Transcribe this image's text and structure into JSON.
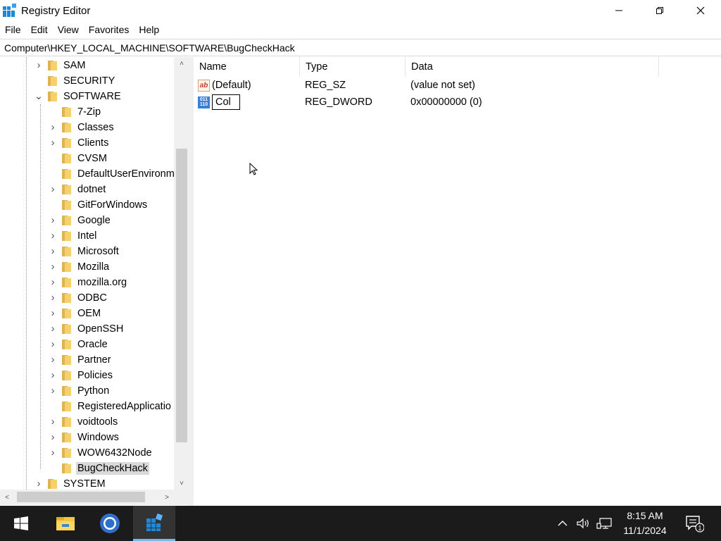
{
  "window": {
    "title": "Registry Editor",
    "controls": [
      "minimize",
      "restore",
      "close"
    ]
  },
  "menu": [
    "File",
    "Edit",
    "View",
    "Favorites",
    "Help"
  ],
  "address": "Computer\\HKEY_LOCAL_MACHINE\\SOFTWARE\\BugCheckHack",
  "tree": {
    "top_level": [
      {
        "label": "SAM",
        "expandable": true
      },
      {
        "label": "SECURITY",
        "expandable": false
      },
      {
        "label": "SOFTWARE",
        "expandable": true,
        "expanded": true
      }
    ],
    "software_children": [
      {
        "label": "7-Zip",
        "expandable": false
      },
      {
        "label": "Classes",
        "expandable": true
      },
      {
        "label": "Clients",
        "expandable": true
      },
      {
        "label": "CVSM",
        "expandable": false
      },
      {
        "label": "DefaultUserEnvironm",
        "expandable": false
      },
      {
        "label": "dotnet",
        "expandable": true
      },
      {
        "label": "GitForWindows",
        "expandable": false
      },
      {
        "label": "Google",
        "expandable": true
      },
      {
        "label": "Intel",
        "expandable": true
      },
      {
        "label": "Microsoft",
        "expandable": true
      },
      {
        "label": "Mozilla",
        "expandable": true
      },
      {
        "label": "mozilla.org",
        "expandable": true
      },
      {
        "label": "ODBC",
        "expandable": true
      },
      {
        "label": "OEM",
        "expandable": true
      },
      {
        "label": "OpenSSH",
        "expandable": true
      },
      {
        "label": "Oracle",
        "expandable": true
      },
      {
        "label": "Partner",
        "expandable": true
      },
      {
        "label": "Policies",
        "expandable": true
      },
      {
        "label": "Python",
        "expandable": true
      },
      {
        "label": "RegisteredApplicatio",
        "expandable": false
      },
      {
        "label": "voidtools",
        "expandable": true
      },
      {
        "label": "Windows",
        "expandable": true
      },
      {
        "label": "WOW6432Node",
        "expandable": true
      },
      {
        "label": "BugCheckHack",
        "expandable": false,
        "selected": true
      }
    ],
    "after": [
      {
        "label": "SYSTEM",
        "expandable": true
      }
    ]
  },
  "list": {
    "columns": [
      "Name",
      "Type",
      "Data"
    ],
    "rows": [
      {
        "icon": "string-value-icon",
        "name": "(Default)",
        "type": "REG_SZ",
        "data": "(value not set)"
      },
      {
        "icon": "binary-value-icon",
        "name": "Col",
        "type": "REG_DWORD",
        "data": "0x00000000 (0)",
        "renaming": true
      }
    ]
  },
  "taskbar": {
    "time": "8:15 AM",
    "date": "11/1/2024",
    "notification_count": "1",
    "apps": [
      "file-explorer-icon",
      "chrome-icon",
      "registry-editor-icon"
    ]
  },
  "colors": {
    "taskbar_bg": "#1b1b1b",
    "selection": "#d9d9d9",
    "folder": "#f5d06b",
    "active_task_underline": "#76b9ed"
  }
}
